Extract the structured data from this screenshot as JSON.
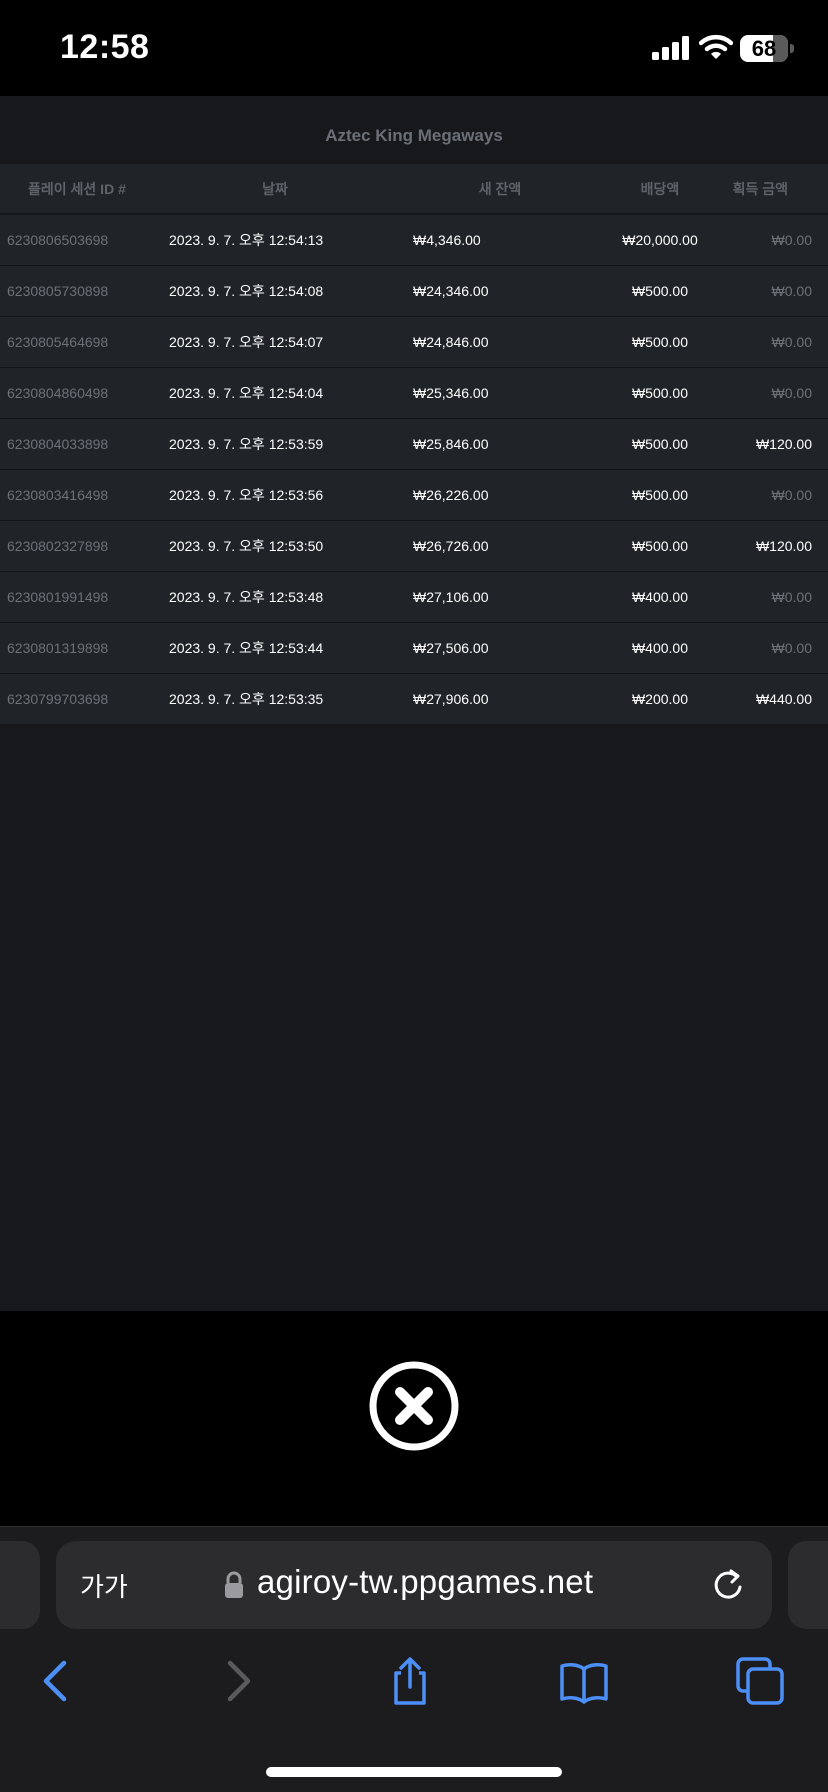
{
  "status_bar": {
    "time": "12:58",
    "battery": "68"
  },
  "table": {
    "title": "Aztec King Megaways",
    "headers": [
      "플레이 세션 ID #",
      "날짜",
      "새 잔액",
      "배당액",
      "획득 금액"
    ],
    "rows": [
      [
        "6230806503698",
        "2023. 9. 7. 오후 12:54:13",
        "₩4,346.00",
        "₩20,000.00",
        "₩0.00"
      ],
      [
        "6230805730898",
        "2023. 9. 7. 오후 12:54:08",
        "₩24,346.00",
        "₩500.00",
        "₩0.00"
      ],
      [
        "6230805464698",
        "2023. 9. 7. 오후 12:54:07",
        "₩24,846.00",
        "₩500.00",
        "₩0.00"
      ],
      [
        "6230804860498",
        "2023. 9. 7. 오후 12:54:04",
        "₩25,346.00",
        "₩500.00",
        "₩0.00"
      ],
      [
        "6230804033898",
        "2023. 9. 7. 오후 12:53:59",
        "₩25,846.00",
        "₩500.00",
        "₩120.00"
      ],
      [
        "6230803416498",
        "2023. 9. 7. 오후 12:53:56",
        "₩26,226.00",
        "₩500.00",
        "₩0.00"
      ],
      [
        "6230802327898",
        "2023. 9. 7. 오후 12:53:50",
        "₩26,726.00",
        "₩500.00",
        "₩120.00"
      ],
      [
        "6230801991498",
        "2023. 9. 7. 오후 12:53:48",
        "₩27,106.00",
        "₩400.00",
        "₩0.00"
      ],
      [
        "6230801319898",
        "2023. 9. 7. 오후 12:53:44",
        "₩27,506.00",
        "₩400.00",
        "₩0.00"
      ],
      [
        "6230799703698",
        "2023. 9. 7. 오후 12:53:35",
        "₩27,906.00",
        "₩200.00",
        "₩440.00"
      ]
    ]
  },
  "browser": {
    "reader_label": "가가",
    "url": "agiroy-tw.ppgames.net"
  },
  "icons": {
    "signal": "signal-icon",
    "wifi": "wifi-icon",
    "close": "close-icon",
    "lock": "lock-icon",
    "reload": "reload-icon",
    "back": "chevron-left-icon",
    "forward": "chevron-right-icon",
    "share": "share-icon",
    "bookmarks": "book-icon",
    "tabs": "tabs-icon"
  },
  "colors": {
    "panel_bg": "#17181c",
    "row_bg": "#202328",
    "muted_text": "#6d7178",
    "accent": "#4c8ff7"
  }
}
